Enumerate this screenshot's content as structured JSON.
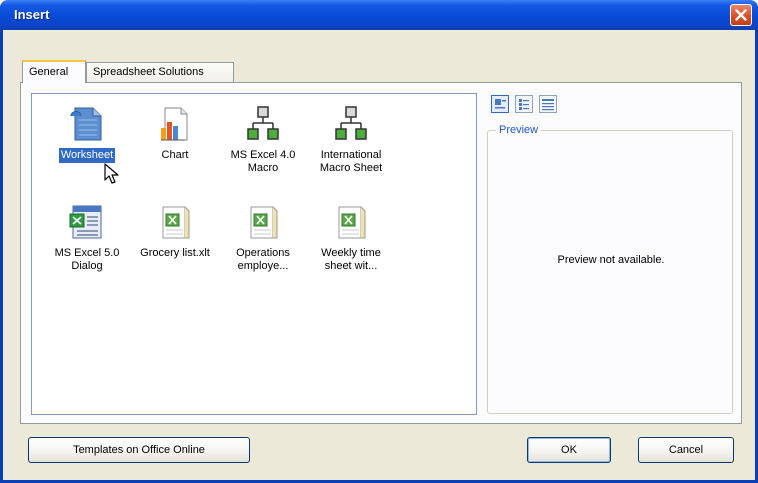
{
  "window": {
    "title": "Insert"
  },
  "tabs": [
    {
      "label": "General"
    },
    {
      "label": "Spreadsheet Solutions"
    }
  ],
  "items": [
    {
      "label": "Worksheet",
      "icon": "worksheet-icon",
      "selected": true
    },
    {
      "label": "Chart",
      "icon": "chart-icon"
    },
    {
      "label": "MS Excel 4.0 Macro",
      "icon": "macro-icon"
    },
    {
      "label": "International Macro Sheet",
      "icon": "macro-icon"
    },
    {
      "label": "MS Excel 5.0 Dialog",
      "icon": "dialog-icon"
    },
    {
      "label": "Grocery list.xlt",
      "icon": "template-icon"
    },
    {
      "label": "Operations employe...",
      "icon": "template-icon"
    },
    {
      "label": "Weekly time sheet wit...",
      "icon": "template-icon"
    }
  ],
  "preview": {
    "legend": "Preview",
    "message": "Preview not available."
  },
  "buttons": {
    "templates_online": "Templates on Office Online",
    "ok": "OK",
    "cancel": "Cancel"
  },
  "colors": {
    "title_bar": "#0a4bd6",
    "selection": "#316ac5",
    "close_button": "#d9542b",
    "dialog_face": "#ece9d8"
  }
}
